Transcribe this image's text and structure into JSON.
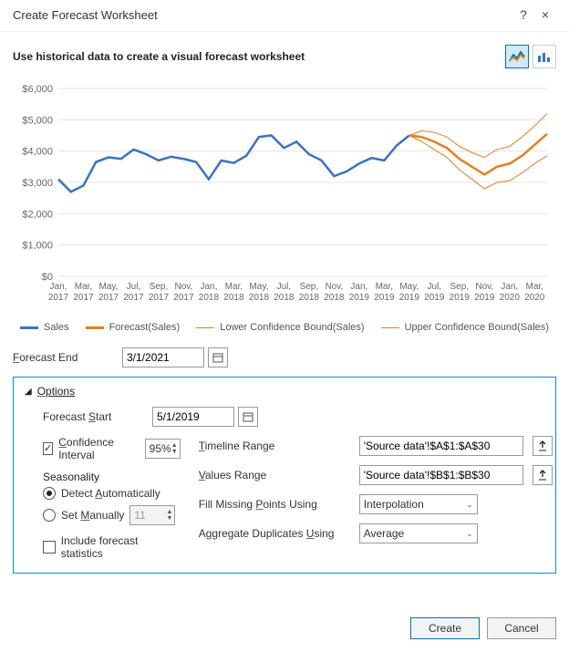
{
  "titlebar": {
    "title": "Create Forecast Worksheet",
    "help": "?",
    "close": "×"
  },
  "subtitle": "Use historical data to create a visual forecast worksheet",
  "chart_toggle": {
    "line_tooltip": "Line chart",
    "column_tooltip": "Column chart"
  },
  "chart_data": {
    "type": "line",
    "ylim": [
      0,
      6000
    ],
    "yticks": [
      0,
      1000,
      2000,
      3000,
      4000,
      5000,
      6000
    ],
    "yticklabels": [
      "$0",
      "$1,000",
      "$2,000",
      "$3,000",
      "$4,000",
      "$5,000",
      "$6,000"
    ],
    "xticklabels_top": [
      "Jan,",
      "Mar,",
      "May,",
      "Jul,",
      "Sep,",
      "Nov,",
      "Jan,",
      "Mar,",
      "May,",
      "Jul,",
      "Sep,",
      "Nov,",
      "Jan,",
      "Mar,",
      "May,",
      "Jul,",
      "Sep,",
      "Nov,",
      "Jan,",
      "Mar,"
    ],
    "xticklabels_bot": [
      "2017",
      "2017",
      "2017",
      "2017",
      "2017",
      "2017",
      "2018",
      "2018",
      "2018",
      "2018",
      "2018",
      "2018",
      "2019",
      "2019",
      "2019",
      "2019",
      "2019",
      "2019",
      "2020",
      "2020"
    ],
    "series": [
      {
        "name": "Sales",
        "values": [
          3100,
          2700,
          2900,
          3650,
          3800,
          3750,
          4050,
          3900,
          3700,
          3820,
          3750,
          3650,
          3100,
          3700,
          3620,
          3850,
          4450,
          4500,
          4100,
          4300,
          3900,
          3700,
          3200,
          3350,
          3600,
          3780,
          3700,
          4180,
          4500
        ]
      },
      {
        "name": "Forecast(Sales)",
        "values_from_index": 28,
        "values": [
          4500,
          4450,
          4300,
          4100,
          3750,
          3500,
          3250,
          3500,
          3600,
          3850,
          4200,
          4550
        ]
      },
      {
        "name": "Lower Confidence Bound(Sales)",
        "values_from_index": 28,
        "values": [
          4500,
          4300,
          4050,
          3800,
          3400,
          3100,
          2800,
          3000,
          3050,
          3300,
          3600,
          3850
        ]
      },
      {
        "name": "Upper Confidence Bound(Sales)",
        "values_from_index": 28,
        "values": [
          4500,
          4650,
          4600,
          4450,
          4150,
          3950,
          3800,
          4050,
          4150,
          4450,
          4800,
          5200
        ]
      }
    ]
  },
  "legend": {
    "sales": "Sales",
    "forecast": "Forecast(Sales)",
    "lower": "Lower Confidence Bound(Sales)",
    "upper": "Upper Confidence Bound(Sales)"
  },
  "form": {
    "forecast_end_label": "Forecast End",
    "forecast_end_value": "3/1/2021",
    "options_label": "Options",
    "forecast_start_label": "Forecast Start",
    "forecast_start_value": "5/1/2019",
    "confidence_label": "Confidence Interval",
    "confidence_value": "95%",
    "seasonality_label": "Seasonality",
    "detect_label": "Detect Automatically",
    "manual_label": "Set Manually",
    "manual_value": "11",
    "include_stats_label": "Include forecast statistics",
    "timeline_label": "Timeline Range",
    "timeline_value": "'Source data'!$A$1:$A$30",
    "values_label": "Values Range",
    "values_value": "'Source data'!$B$1:$B$30",
    "fill_label": "Fill Missing Points Using",
    "fill_value": "Interpolation",
    "agg_label": "Aggregate Duplicates Using",
    "agg_value": "Average"
  },
  "footer": {
    "create": "Create",
    "cancel": "Cancel"
  }
}
